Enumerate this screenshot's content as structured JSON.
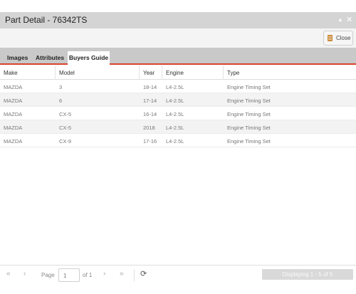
{
  "window": {
    "title": "Part Detail - 76342TS",
    "collapse_icon": "chevron-up-icon",
    "close_icon": "close-icon"
  },
  "toolbar": {
    "close_label": "Close",
    "close_icon": "close-document-icon"
  },
  "tabs": [
    {
      "label": "Images",
      "active": false
    },
    {
      "label": "Attributes",
      "active": false
    },
    {
      "label": "Buyers Guide",
      "active": true
    }
  ],
  "grid": {
    "columns": [
      "Make",
      "Model",
      "Year",
      "Engine",
      "Type"
    ],
    "rows": [
      [
        "MAZDA",
        "3",
        "18-14",
        "L4-2.5L",
        "Engine Timing Set"
      ],
      [
        "MAZDA",
        "6",
        "17-14",
        "L4-2.5L",
        "Engine Timing Set"
      ],
      [
        "MAZDA",
        "CX-5",
        "16-14",
        "L4-2.5L",
        "Engine Timing Set"
      ],
      [
        "MAZDA",
        "CX-5",
        "2018",
        "L4-2.5L",
        "Engine Timing Set"
      ],
      [
        "MAZDA",
        "CX-9",
        "17-16",
        "L4-2.5L",
        "Engine Timing Set"
      ]
    ]
  },
  "pager": {
    "page_label": "Page",
    "page_value": "1",
    "of_label": "of 1",
    "display_text": "Displaying 1 - 5 of 5",
    "first_glyph": "«",
    "prev_glyph": "‹",
    "next_glyph": "›",
    "last_glyph": "»",
    "refresh_glyph": "⟳"
  },
  "colors": {
    "accent": "#d9442c",
    "titlebar": "#d4d4d4",
    "tabbar": "#c9c9c9"
  }
}
